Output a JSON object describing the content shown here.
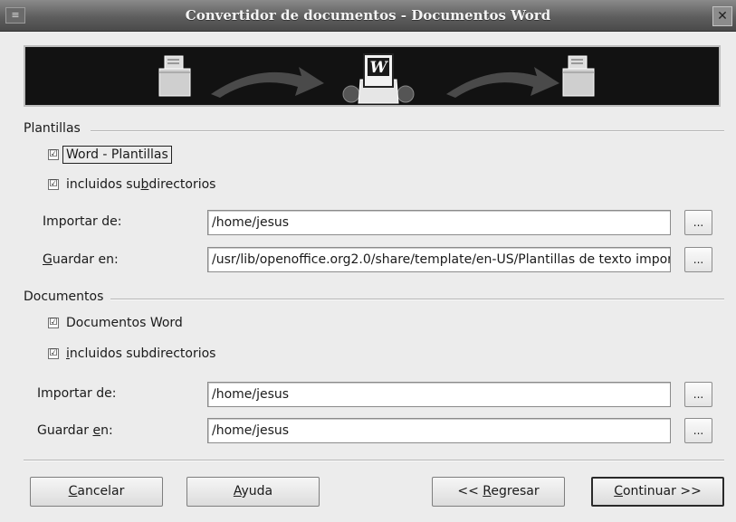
{
  "window": {
    "title": "Convertidor de documentos - Documentos Word",
    "menu_glyph": "≡",
    "close_glyph": "✕"
  },
  "banner": {
    "icons": [
      "document-folder-icon",
      "arrow-right-icon",
      "word-document-gears-icon",
      "arrow-right-icon",
      "document-folder-icon"
    ],
    "word_glyph": "W"
  },
  "templates": {
    "section_label": "Plantillas",
    "word_check": {
      "label": "Word - Plantillas",
      "checked": true
    },
    "subdirs_check": {
      "label_pre": "incluidos su",
      "label_ul": "b",
      "label_post": "directorios",
      "checked": true
    },
    "import_label": "Importar de:",
    "import_value": "/home/jesus",
    "save_label_ul": "G",
    "save_label_rest": "uardar en:",
    "save_value": "/usr/lib/openoffice.org2.0/share/template/en-US/Plantillas de texto impor",
    "browse_label": "..."
  },
  "documents": {
    "section_label": "Documentos",
    "word_check": {
      "label": "Documentos Word",
      "checked": true
    },
    "subdirs_check": {
      "label_ul": "i",
      "label_rest": "ncluidos subdirectorios",
      "checked": true
    },
    "import_label": "Importar de:",
    "import_value": "/home/jesus",
    "save_label_pre": "Guardar ",
    "save_label_ul": "e",
    "save_label_post": "n:",
    "save_value": "/home/jesus",
    "browse_label": "..."
  },
  "buttons": {
    "cancel_ul": "C",
    "cancel_rest": "ancelar",
    "help_ul": "A",
    "help_rest": "yuda",
    "back_pre": "<< ",
    "back_ul": "R",
    "back_rest": "egresar",
    "continue_ul": "C",
    "continue_rest": "ontinuar >>"
  },
  "check_glyph": "☑"
}
